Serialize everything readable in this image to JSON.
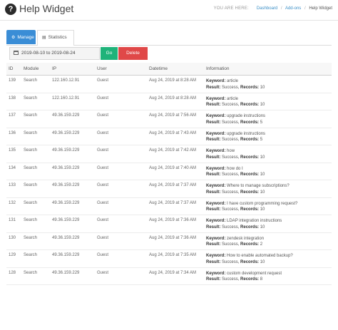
{
  "header": {
    "title": "Help Widget",
    "breadcrumb": {
      "you_are_here": "YOU ARE HERE:",
      "items": [
        "Dashboard",
        "Add-ons",
        "Help Widget"
      ]
    }
  },
  "tabs": [
    {
      "label": "Manage",
      "active": true
    },
    {
      "label": "Statistics",
      "active": false
    }
  ],
  "filters": {
    "date_range": "2019-08-10 to 2019-08-24",
    "go_label": "Go",
    "delete_label": "Delete"
  },
  "table": {
    "columns": [
      "ID",
      "Module",
      "IP",
      "User",
      "Datetime",
      "Information"
    ],
    "labels": {
      "keyword": "Keyword:",
      "result": "Result:",
      "records": "Records:"
    },
    "rows": [
      {
        "id": "139",
        "module": "Search",
        "ip": "122.160.12.91",
        "user": "Guest",
        "datetime": "Aug 24, 2019 at 8:28 AM",
        "keyword": "article",
        "result": "Success,",
        "records": "10"
      },
      {
        "id": "138",
        "module": "Search",
        "ip": "122.160.12.91",
        "user": "Guest",
        "datetime": "Aug 24, 2019 at 8:28 AM",
        "keyword": "article",
        "result": "Success,",
        "records": "10"
      },
      {
        "id": "137",
        "module": "Search",
        "ip": "49.36.159.229",
        "user": "Guest",
        "datetime": "Aug 24, 2019 at 7:56 AM",
        "keyword": "upgrade instructions",
        "result": "Success,",
        "records": "5"
      },
      {
        "id": "136",
        "module": "Search",
        "ip": "49.36.159.229",
        "user": "Guest",
        "datetime": "Aug 24, 2019 at 7:43 AM",
        "keyword": "upgrade instructions",
        "result": "Success,",
        "records": "5"
      },
      {
        "id": "135",
        "module": "Search",
        "ip": "49.36.159.229",
        "user": "Guest",
        "datetime": "Aug 24, 2019 at 7:42 AM",
        "keyword": "how",
        "result": "Success,",
        "records": "10"
      },
      {
        "id": "134",
        "module": "Search",
        "ip": "49.36.159.229",
        "user": "Guest",
        "datetime": "Aug 24, 2019 at 7:40 AM",
        "keyword": "how do I",
        "result": "Success,",
        "records": "10"
      },
      {
        "id": "133",
        "module": "Search",
        "ip": "49.36.159.229",
        "user": "Guest",
        "datetime": "Aug 24, 2019 at 7:37 AM",
        "keyword": "Where to manage subscriptions?",
        "result": "Success,",
        "records": "10"
      },
      {
        "id": "132",
        "module": "Search",
        "ip": "49.36.159.229",
        "user": "Guest",
        "datetime": "Aug 24, 2019 at 7:37 AM",
        "keyword": "I have custom programming request?",
        "result": "Success,",
        "records": "10"
      },
      {
        "id": "131",
        "module": "Search",
        "ip": "49.36.159.229",
        "user": "Guest",
        "datetime": "Aug 24, 2019 at 7:36 AM",
        "keyword": "LDAP integration instructions",
        "result": "Success,",
        "records": "10"
      },
      {
        "id": "130",
        "module": "Search",
        "ip": "49.36.159.229",
        "user": "Guest",
        "datetime": "Aug 24, 2019 at 7:36 AM",
        "keyword": "zendesk integration",
        "result": "Success,",
        "records": "2"
      },
      {
        "id": "129",
        "module": "Search",
        "ip": "49.36.159.229",
        "user": "Guest",
        "datetime": "Aug 24, 2019 at 7:35 AM",
        "keyword": "How to enable automated backup?",
        "result": "Success,",
        "records": "10"
      },
      {
        "id": "128",
        "module": "Search",
        "ip": "49.36.159.229",
        "user": "Guest",
        "datetime": "Aug 24, 2019 at 7:34 AM",
        "keyword": "custom development request",
        "result": "Success,",
        "records": "8"
      }
    ]
  }
}
